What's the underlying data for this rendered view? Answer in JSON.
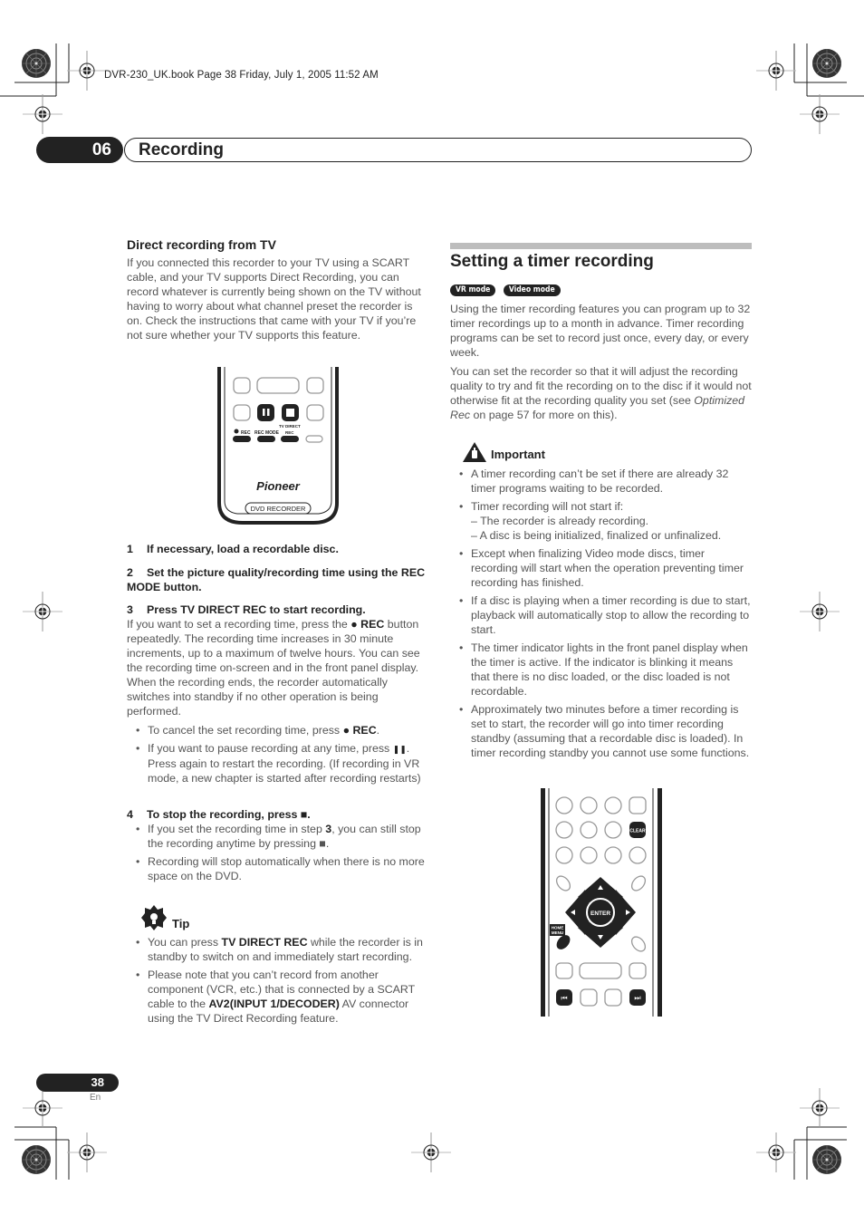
{
  "print_header": "DVR-230_UK.book  Page 38  Friday, July 1, 2005  11:52 AM",
  "chapter": {
    "number": "06",
    "title": "Recording"
  },
  "left": {
    "heading": "Direct recording from TV",
    "intro": "If you connected this recorder to your TV using a SCART cable, and your TV supports Direct Recording, you can record whatever is currently being shown on the TV without having to worry about what channel preset the recorder is on. Check the instructions that came with your TV if you’re not sure whether your TV supports this feature.",
    "remote": {
      "labels": {
        "rec": "● REC",
        "rec_mode": "REC MODE",
        "tv_direct_1": "TV DIRECT",
        "tv_direct_2": "REC"
      },
      "brand": "Pioneer",
      "model_label": "DVD RECORDER"
    },
    "steps": [
      {
        "num": "1",
        "text": "If necessary, load a recordable disc."
      },
      {
        "num": "2",
        "text": "Set the picture quality/recording time using the REC MODE button."
      },
      {
        "num": "3",
        "text": "Press TV DIRECT REC to start recording."
      }
    ],
    "step3_body_pre": "If you want to set a recording time, press the ",
    "rec_button": "● REC",
    "step3_body_post": " button repeatedly. The recording time increases in 30 minute increments, up to a maximum of twelve hours. You can see the recording time on-screen and in the front panel display. When the recording ends, the recorder automatically switches into standby if no other operation is being performed.",
    "step3_bullets": {
      "b1_pre": "To cancel the set recording time, press ",
      "b1_key": "● REC",
      "b1_post": ".",
      "b2_pre": "If you want to pause recording at any time, press ",
      "b2_key": "❚❚",
      "b2_post": ". Press again to restart the recording. (If recording in VR mode, a new chapter is started after recording restarts)"
    },
    "step4": {
      "num": "4",
      "text": "To stop the recording, press  ■."
    },
    "step4_bullets": {
      "b1_pre": "If you set the recording time in step ",
      "b1_key": "3",
      "b1_post": ", you can still stop the recording anytime by pressing ■.",
      "b2": "Recording will stop automatically when there is no more space on the DVD."
    },
    "tip": {
      "label": "Tip",
      "b1_pre": "You can press ",
      "b1_key": "TV DIRECT REC",
      "b1_post": " while the recorder is in standby to switch on and immediately start recording.",
      "b2_pre": "Please note that you can’t record from another component (VCR, etc.) that is connected by a SCART cable to the ",
      "b2_key": "AV2(INPUT 1/DECODER)",
      "b2_post": " AV connector using the TV Direct Recording feature."
    }
  },
  "right": {
    "heading": "Setting a timer recording",
    "modes": [
      "VR mode",
      "Video mode"
    ],
    "p1": "Using the timer recording features you can program up to 32 timer recordings up to a month in advance. Timer recording programs can be set to record just once, every day, or every week.",
    "p2_pre": "You can set the recorder so that it will adjust the recording quality to try and fit the recording on to the disc if it would not otherwise fit at the recording quality you set (see ",
    "p2_italic": "Optimized Rec",
    "p2_post": " on page 57 for more on this).",
    "important": {
      "label": "Important",
      "items": [
        "A timer recording can’t be set if there are already 32 timer programs waiting to be recorded.",
        "Timer recording will not start if:",
        "Except when finalizing Video mode discs, timer recording will start when the operation preventing timer recording has finished.",
        "If a disc is playing when a timer recording is due to start, playback will automatically stop to allow the recording to start.",
        "The timer indicator lights in the front panel display when the timer is active. If the indicator is blinking it means that there is no disc loaded, or the disc loaded is not recordable.",
        "Approximately two minutes before a timer recording is set to start, the recorder will go into timer recording standby (assuming that a recordable disc is loaded). In timer recording standby you cannot use some functions."
      ],
      "subitems": [
        "– The recorder is already recording.",
        "– A disc is being initialized, finalized or unfinalized."
      ]
    },
    "remote": {
      "clear": "CLEAR",
      "enter": "ENTER",
      "home_menu_1": "HOME",
      "home_menu_2": "MENU",
      "prev": "⏮",
      "next": "⏭"
    }
  },
  "footer": {
    "page": "38",
    "lang": "En"
  }
}
